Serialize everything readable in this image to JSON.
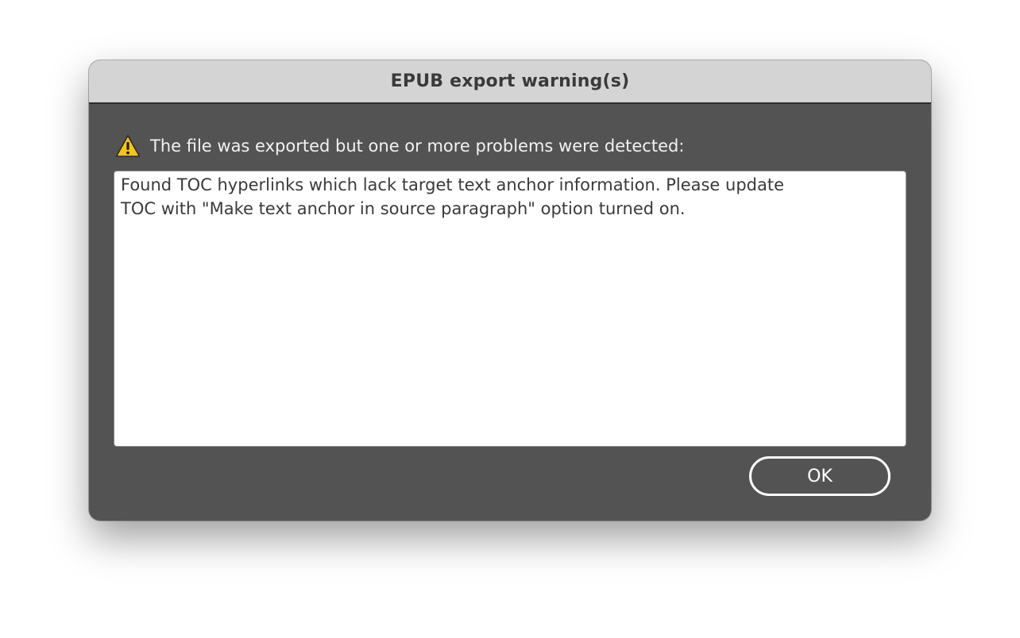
{
  "dialog": {
    "title": "EPUB export warning(s)",
    "icon": "warning-triangle-icon",
    "message": "The file was exported but one or more problems were detected:",
    "details": "Found TOC hyperlinks which lack target text anchor information. Please update\nTOC with \"Make text anchor in source paragraph\" option turned on.",
    "ok_label": "OK"
  },
  "colors": {
    "dialog_background": "#535353",
    "titlebar_background": "#d4d4d4",
    "warning_yellow": "#f5c518"
  }
}
